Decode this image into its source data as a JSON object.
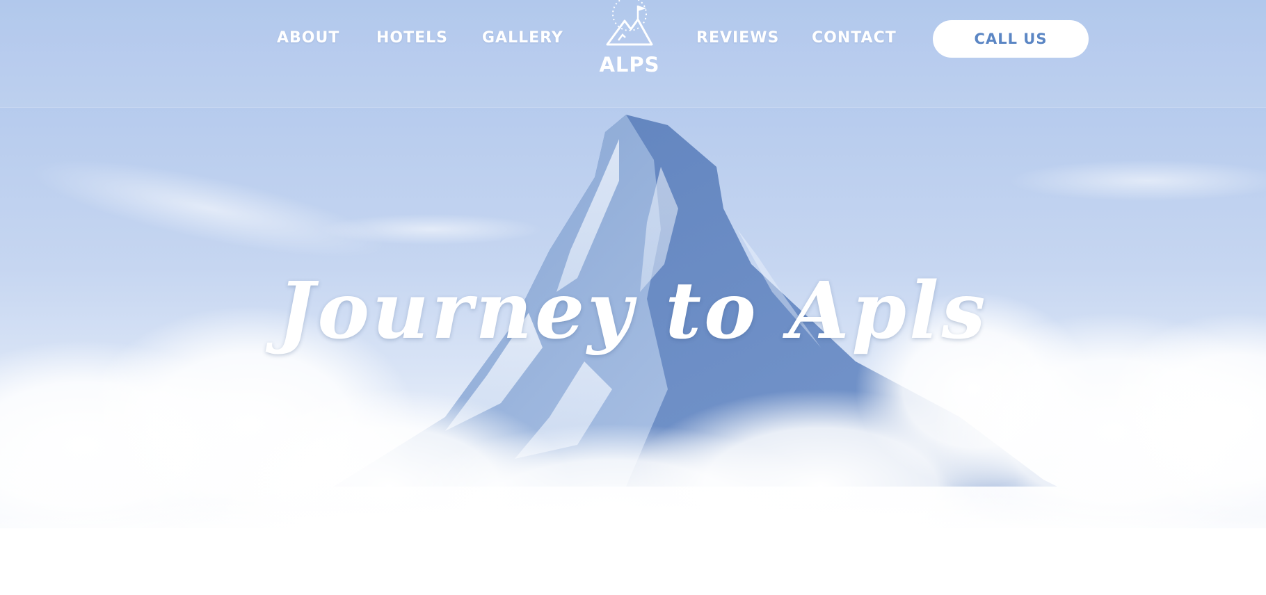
{
  "nav": {
    "links": [
      "ABOUT",
      "HOTELS",
      "GALLERY",
      "REVIEWS",
      "CONTACT"
    ],
    "cta_label": "CALL US"
  },
  "logo": {
    "text": "ALPS",
    "icon": "mountain-flag-icon"
  },
  "hero": {
    "title": "Journey to Apls",
    "image": "snowy-mountain-peak-in-clouds"
  },
  "colors": {
    "sky": "#a9c2ea",
    "button_text": "#5b86c4",
    "text": "#ffffff"
  }
}
